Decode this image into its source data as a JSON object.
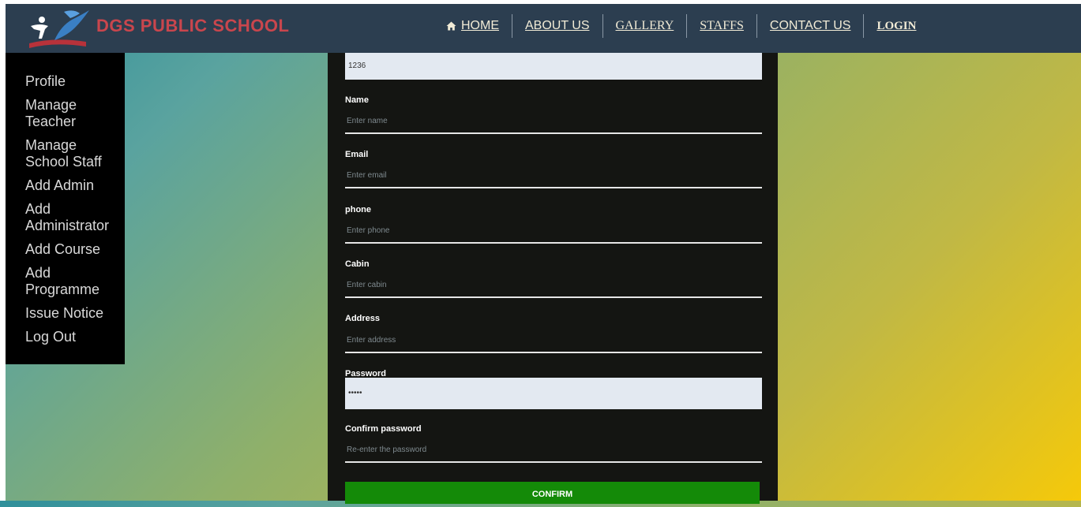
{
  "header": {
    "brand": "DGS PUBLIC SCHOOL",
    "nav": [
      {
        "label": "HOME",
        "icon": "home-icon"
      },
      {
        "label": "ABOUT US"
      },
      {
        "label": "GALLERY"
      },
      {
        "label": "STAFFS"
      },
      {
        "label": "CONTACT US"
      },
      {
        "label": "LOGIN"
      }
    ]
  },
  "sidebar": {
    "items": [
      {
        "label": "Profile"
      },
      {
        "label": "Manage Teacher"
      },
      {
        "label": "Manage School Staff"
      },
      {
        "label": "Add Admin"
      },
      {
        "label": "Add Administrator"
      },
      {
        "label": "Add Course"
      },
      {
        "label": "Add Programme"
      },
      {
        "label": "Issue Notice"
      },
      {
        "label": "Log Out"
      }
    ]
  },
  "form": {
    "id_value": "1236",
    "name_label": "Name",
    "name_placeholder": "Enter name",
    "email_label": "Email",
    "email_placeholder": "Enter email",
    "phone_label": "phone",
    "phone_placeholder": "Enter phone",
    "cabin_label": "Cabin",
    "cabin_placeholder": "Enter cabin",
    "address_label": "Address",
    "address_placeholder": "Enter address",
    "password_label": "Password",
    "password_value": "•••••",
    "confirm_label": "Confirm password",
    "confirm_placeholder": "Re-enter the password",
    "submit_label": "CONFIRM"
  },
  "colors": {
    "header_bg": "#2c3e50",
    "brand": "#c9464d",
    "sidebar_bg": "#000000",
    "panel_bg": "#141512",
    "button_bg": "#148a08"
  }
}
